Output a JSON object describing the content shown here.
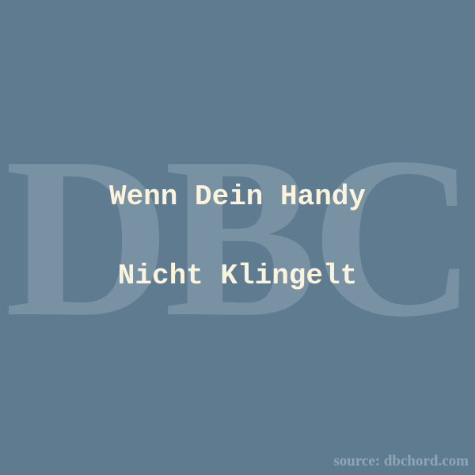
{
  "watermark": "DBC",
  "title": {
    "line1": "Wenn Dein Handy",
    "line2": "Nicht Klingelt"
  },
  "source": "source: dbchord.com",
  "colors": {
    "background": "#5f7b8f",
    "watermark": "#7a93a5",
    "title_text": "#fbf3dc",
    "source_text": "#8fa6b7"
  }
}
